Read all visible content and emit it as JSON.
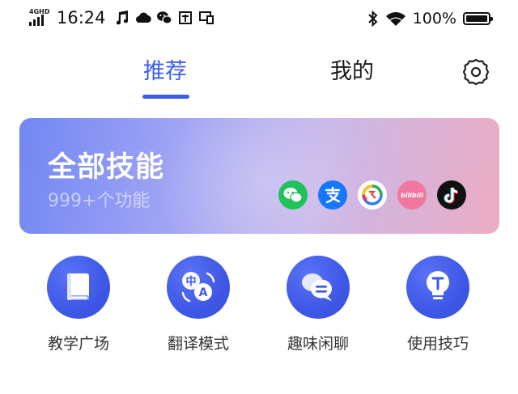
{
  "status_bar": {
    "network": "4GHD",
    "time": "16:24",
    "left_icons": [
      "music-note-icon",
      "cloud-icon",
      "wechat-icon",
      "screenshot-icon",
      "cast-icon"
    ],
    "right_icons": [
      "bluetooth-icon",
      "wifi-icon"
    ],
    "battery_percent": "100%",
    "battery_level": 1.0
  },
  "tabs": [
    {
      "label": "推荐",
      "active": true
    },
    {
      "label": "我的",
      "active": false
    }
  ],
  "settings_icon": "gear-icon",
  "banner": {
    "title": "全部技能",
    "subtitle": "999+个功能",
    "apps": [
      "wechat",
      "alipay",
      "tencent-news",
      "bilibili",
      "tiktok"
    ],
    "bilibili_text": "bilibili"
  },
  "features": [
    {
      "label": "教学广场",
      "icon": "book-icon"
    },
    {
      "label": "翻译模式",
      "icon": "translate-icon",
      "glyph_zh": "中",
      "glyph_en": "A"
    },
    {
      "label": "趣味闲聊",
      "icon": "chat-bubbles-icon"
    },
    {
      "label": "使用技巧",
      "icon": "lightbulb-icon"
    }
  ],
  "colors": {
    "accent": "#3b5ee8",
    "feature_bg": "#3e57e6",
    "banner_gradient": [
      "#7187f3",
      "#c9b8ea",
      "#ecacc2"
    ]
  }
}
